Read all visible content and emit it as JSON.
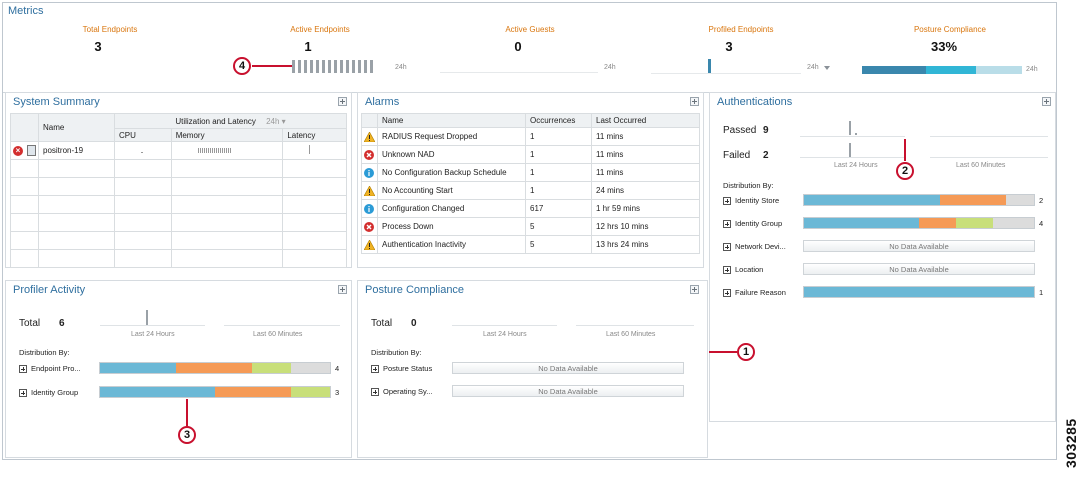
{
  "metrics": {
    "title": "Metrics",
    "items": [
      {
        "label": "Total Endpoints",
        "value": "3"
      },
      {
        "label": "Active Endpoints",
        "value": "1",
        "range": "24h"
      },
      {
        "label": "Active Guests",
        "value": "0",
        "range": "24h"
      },
      {
        "label": "Profiled Endpoints",
        "value": "3",
        "range": "24h"
      },
      {
        "label": "Posture Compliance",
        "value": "33%",
        "range": "24h"
      }
    ],
    "posture_bar_fractions": [
      0.4,
      0.31,
      0.29
    ]
  },
  "system_summary": {
    "title": "System Summary",
    "group_header": "Utilization and Latency",
    "range": "24h",
    "columns": [
      "Name",
      "CPU",
      "Memory",
      "Latency"
    ],
    "rows": [
      {
        "name": "positron-19"
      }
    ]
  },
  "alarms": {
    "title": "Alarms",
    "columns": [
      "Name",
      "Occurrences",
      "Last Occurred"
    ],
    "rows": [
      {
        "icon": "warning-icon",
        "name": "RADIUS Request Dropped",
        "occurrences": "1",
        "last": "11 mins"
      },
      {
        "icon": "error-icon",
        "name": "Unknown NAD",
        "occurrences": "1",
        "last": "11 mins"
      },
      {
        "icon": "info-icon",
        "name": "No Configuration Backup Schedule",
        "occurrences": "1",
        "last": "11 mins"
      },
      {
        "icon": "warning-icon",
        "name": "No Accounting Start",
        "occurrences": "1",
        "last": "24 mins"
      },
      {
        "icon": "info-icon",
        "name": "Configuration Changed",
        "occurrences": "617",
        "last": "1 hr 59 mins"
      },
      {
        "icon": "error-icon",
        "name": "Process Down",
        "occurrences": "5",
        "last": "12 hrs 10 mins"
      },
      {
        "icon": "warning-icon",
        "name": "Authentication Inactivity",
        "occurrences": "5",
        "last": "13 hrs 24 mins"
      }
    ]
  },
  "authentications": {
    "title": "Authentications",
    "passed_label": "Passed",
    "passed_value": "9",
    "failed_label": "Failed",
    "failed_value": "2",
    "last24": "Last 24 Hours",
    "last60": "Last 60 Minutes",
    "distribution_label": "Distribution By:",
    "rows": [
      {
        "label": "Identity Store",
        "count": "2",
        "fractions": [
          0.59,
          0.29
        ]
      },
      {
        "label": "Identity Group",
        "count": "4",
        "fractions": [
          0.5,
          0.16,
          0.16,
          0.16
        ]
      },
      {
        "label": "Network Devi...",
        "nodata": "No Data Available"
      },
      {
        "label": "Location",
        "nodata": "No Data Available"
      },
      {
        "label": "Failure Reason",
        "count": "1",
        "fractions": [
          1.0
        ]
      }
    ]
  },
  "profiler": {
    "title": "Profiler Activity",
    "total_label": "Total",
    "total_value": "6",
    "last24": "Last 24 Hours",
    "last60": "Last 60 Minutes",
    "distribution_label": "Distribution By:",
    "rows": [
      {
        "label": "Endpoint Pro...",
        "count": "4",
        "fractions": [
          0.33,
          0.33,
          0.17,
          0.17
        ]
      },
      {
        "label": "Identity Group",
        "count": "3",
        "fractions": [
          0.5,
          0.33,
          0.17
        ]
      }
    ]
  },
  "posture": {
    "title": "Posture Compliance",
    "total_label": "Total",
    "total_value": "0",
    "last24": "Last 24 Hours",
    "last60": "Last 60 Minutes",
    "distribution_label": "Distribution By:",
    "rows": [
      {
        "label": "Posture Status",
        "nodata": "No Data Available"
      },
      {
        "label": "Operating Sy...",
        "nodata": "No Data Available"
      }
    ]
  },
  "callouts": [
    "1",
    "2",
    "3",
    "4"
  ],
  "figure_code": "303285",
  "colors": {
    "blue": "#6bb8d6",
    "orange": "#f59a56",
    "green": "#c8df7a",
    "gray": "#dcdcdc",
    "posture_dark": "#3a87ad",
    "posture_mid": "#31b6d6",
    "posture_light": "#b9dde8"
  }
}
